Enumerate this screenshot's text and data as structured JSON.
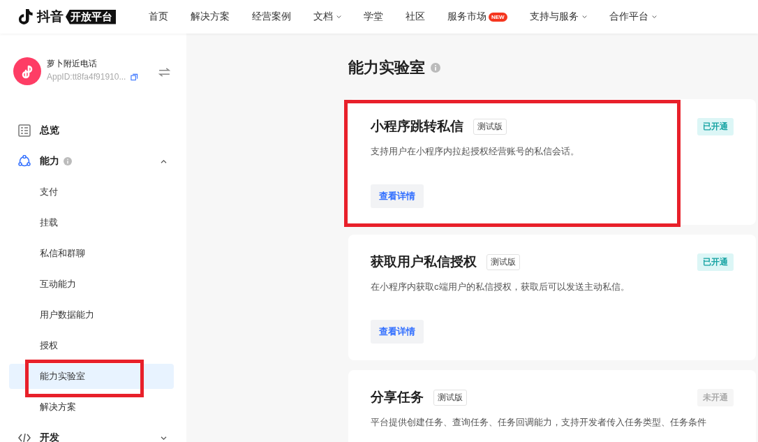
{
  "header": {
    "logo": {
      "brand": "抖音",
      "product": "开放平台"
    },
    "nav": [
      {
        "label": "首页",
        "dropdown": false
      },
      {
        "label": "解决方案",
        "dropdown": false
      },
      {
        "label": "经营案例",
        "dropdown": false
      },
      {
        "label": "文档",
        "dropdown": true
      },
      {
        "label": "学堂",
        "dropdown": false
      },
      {
        "label": "社区",
        "dropdown": false
      },
      {
        "label": "服务市场",
        "dropdown": false,
        "badge": "NEW"
      },
      {
        "label": "支持与服务",
        "dropdown": true
      },
      {
        "label": "合作平台",
        "dropdown": true
      }
    ]
  },
  "sidebar": {
    "app": {
      "name": "萝卜附近电话",
      "app_id": "AppID:tt8fa4f91910..."
    },
    "items": [
      {
        "label": "总览",
        "kind": "overview"
      },
      {
        "label": "能力",
        "kind": "ability",
        "expanded": true,
        "info": true,
        "children": [
          {
            "label": "支付",
            "selected": false,
            "highlighted": false
          },
          {
            "label": "挂载",
            "selected": false,
            "highlighted": false
          },
          {
            "label": "私信和群聊",
            "selected": false,
            "highlighted": false
          },
          {
            "label": "互动能力",
            "selected": false,
            "highlighted": false
          },
          {
            "label": "用户数据能力",
            "selected": false,
            "highlighted": false
          },
          {
            "label": "授权",
            "selected": false,
            "highlighted": false
          },
          {
            "label": "能力实验室",
            "selected": true,
            "highlighted": true
          },
          {
            "label": "解决方案",
            "selected": false,
            "highlighted": false
          }
        ]
      },
      {
        "label": "开发",
        "kind": "develop",
        "expanded": false
      }
    ]
  },
  "main": {
    "title": "能力实验室",
    "cards": [
      {
        "title": "小程序跳转私信",
        "tag": "测试版",
        "status": "已开通",
        "enabled": true,
        "highlighted": true,
        "description": "支持用户在小程序内拉起授权经营账号的私信会话。",
        "button": "查看详情"
      },
      {
        "title": "获取用户私信授权",
        "tag": "测试版",
        "status": "已开通",
        "enabled": true,
        "highlighted": false,
        "description": "在小程序内获取c端用户的私信授权，获取后可以发送主动私信。",
        "button": "查看详情"
      },
      {
        "title": "分享任务",
        "tag": "测试版",
        "status": "未开通",
        "enabled": false,
        "highlighted": false,
        "description": "平台提供创建任务、查询任务、任务回调能力，支持开发者传入任务类型、任务条件"
      }
    ]
  }
}
